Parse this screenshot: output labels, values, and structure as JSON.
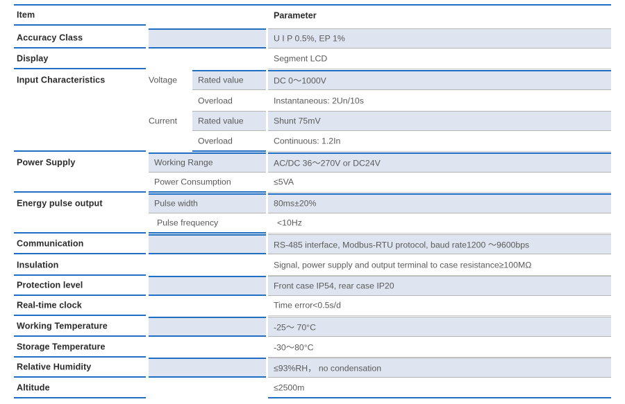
{
  "table": {
    "headers": {
      "item": "Item",
      "parameter": "Parameter"
    },
    "colors": {
      "rule_blue": "#1f6ec4",
      "shade_fill": "#dee5f0",
      "shade_border": "#b3b3b3",
      "item_text": "#2b2b2b",
      "value_text": "#5a5a5a"
    },
    "rows": [
      {
        "item": "Accuracy Class",
        "sub_a": "",
        "sub_b": "",
        "parameter": "U I P 0.5%, EP 1%"
      },
      {
        "item": "Display",
        "sub_a": "",
        "sub_b": "",
        "parameter": "Segment LCD"
      },
      {
        "item": "Input Characteristics",
        "sub_a": "Voltage",
        "sub_b": "Rated value",
        "parameter": "DC 0～1000V"
      },
      {
        "item": "",
        "sub_a": "",
        "sub_b": "Overload",
        "parameter": "Instantaneous: 2Un/10s"
      },
      {
        "item": "",
        "sub_a": "Current",
        "sub_b": "Rated value",
        "parameter": "Shunt 75mV"
      },
      {
        "item": "",
        "sub_a": "",
        "sub_b": "Overload",
        "parameter": "Continuous: 1.2In"
      },
      {
        "item": "Power Supply",
        "sub_a": "",
        "sub_b": "Working Range",
        "parameter": "AC/DC 36～270V or DC24V"
      },
      {
        "item": "",
        "sub_a": "",
        "sub_b": "Power Consumption",
        "parameter": "≤5VA"
      },
      {
        "item": "Energy pulse output",
        "sub_a": "",
        "sub_b": "Pulse width",
        "parameter": "80ms±20%"
      },
      {
        "item": "",
        "sub_a": "",
        "sub_b": "Pulse frequency",
        "parameter": "<10Hz"
      },
      {
        "item": "Communication",
        "sub_a": "",
        "sub_b": "",
        "parameter": "RS-485 interface, Modbus-RTU protocol, baud rate1200 ～9600bps"
      },
      {
        "item": "Insulation",
        "sub_a": "",
        "sub_b": "",
        "parameter": "Signal, power supply and output terminal to case resistance≥100MΩ"
      },
      {
        "item": "Protection level",
        "sub_a": "",
        "sub_b": "",
        "parameter": "Front case IP54, rear case IP20"
      },
      {
        "item": "Real-time clock",
        "sub_a": "",
        "sub_b": "",
        "parameter": "Time error<0.5s/d"
      },
      {
        "item": "Working Temperature",
        "sub_a": "",
        "sub_b": "",
        "parameter": "-25～ 70°C"
      },
      {
        "item": "Storage Temperature",
        "sub_a": "",
        "sub_b": "",
        "parameter": "-30～80°C"
      },
      {
        "item": "Relative Humidity",
        "sub_a": "",
        "sub_b": "",
        "parameter": "≤93%RH， no condensation"
      },
      {
        "item": "Altitude",
        "sub_a": "",
        "sub_b": "",
        "parameter": "≤2500m"
      }
    ]
  }
}
